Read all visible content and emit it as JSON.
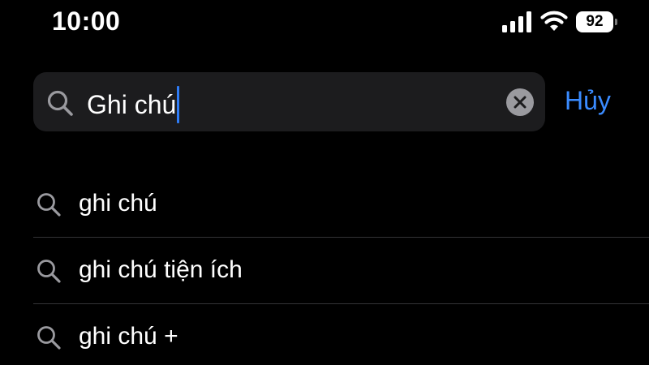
{
  "status_bar": {
    "time": "10:00",
    "battery_level": "92",
    "icons": [
      "signal-icon",
      "wifi-icon",
      "battery-icon"
    ]
  },
  "search": {
    "value": "Ghi chú",
    "cancel_label": "Hủy",
    "icons": [
      "search-icon",
      "clear-icon"
    ]
  },
  "suggestions": [
    {
      "label": "ghi chú"
    },
    {
      "label": "ghi chú tiện ích"
    },
    {
      "label": "ghi chú +"
    }
  ],
  "colors": {
    "background": "#000000",
    "search_field": "#1c1c1e",
    "accent": "#3a8bff",
    "caret": "#2f7cf6",
    "secondary_icon": "#9a9a9f",
    "divider": "#333336"
  }
}
